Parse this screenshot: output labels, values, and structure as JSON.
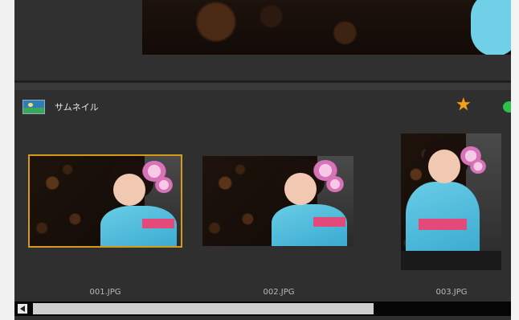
{
  "panel": {
    "title": "サムネイル",
    "icon": "image-icon",
    "favorite_icon": "star-icon",
    "status_icon": "green-icon"
  },
  "thumbnails": [
    {
      "label": "001.JPG",
      "selected": true
    },
    {
      "label": "002.JPG",
      "selected": false
    },
    {
      "label": "003.JPG",
      "selected": false
    }
  ],
  "colors": {
    "selection_border": "#d59a1a",
    "panel_background": "#2f2f2f",
    "star": "#f2a21a"
  },
  "scroll": {
    "horizontal_position": 0.0
  }
}
